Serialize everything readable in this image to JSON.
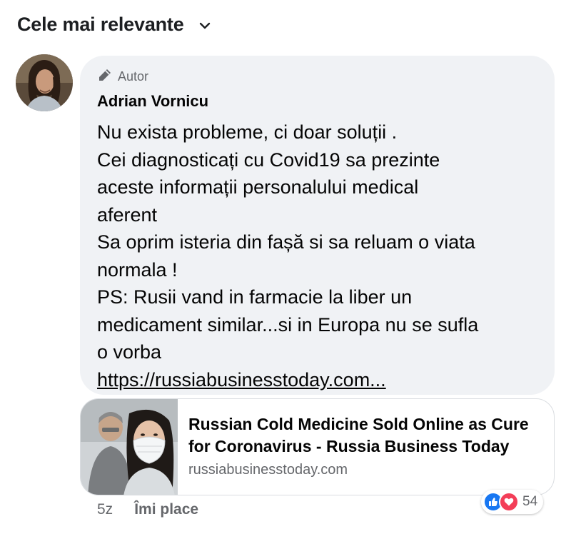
{
  "sort": {
    "label": "Cele mai relevante",
    "icon": "chevron-down-icon"
  },
  "comment": {
    "author_badge": "Autor",
    "author_badge_icon": "pencil-icon",
    "author_name": "Adrian Vornicu",
    "lines": [
      "Nu exista probleme, ci doar soluții .",
      "Cei diagnosticați cu Covid19 sa prezinte",
      "aceste informații personalului medical",
      "aferent",
      "Sa oprim isteria din fașă si sa reluam o viata",
      "normala !",
      "PS: Rusii vand in farmacie la liber un",
      "medicament similar...si in Europa nu se sufla",
      "o vorba"
    ],
    "link_text": "https://russiabusinesstoday.com..."
  },
  "link_preview": {
    "title": "Russian Cold Medicine Sold Online as Cure for Coronavirus - Russia Business Today",
    "domain": "russiabusinesstoday.com"
  },
  "footer": {
    "time": "5z",
    "like_label": "Îmi place"
  },
  "reactions": {
    "types": [
      "like-icon",
      "love-icon"
    ],
    "count": "54",
    "colors": {
      "like": "#1877f2",
      "love": "#f33e58"
    }
  }
}
